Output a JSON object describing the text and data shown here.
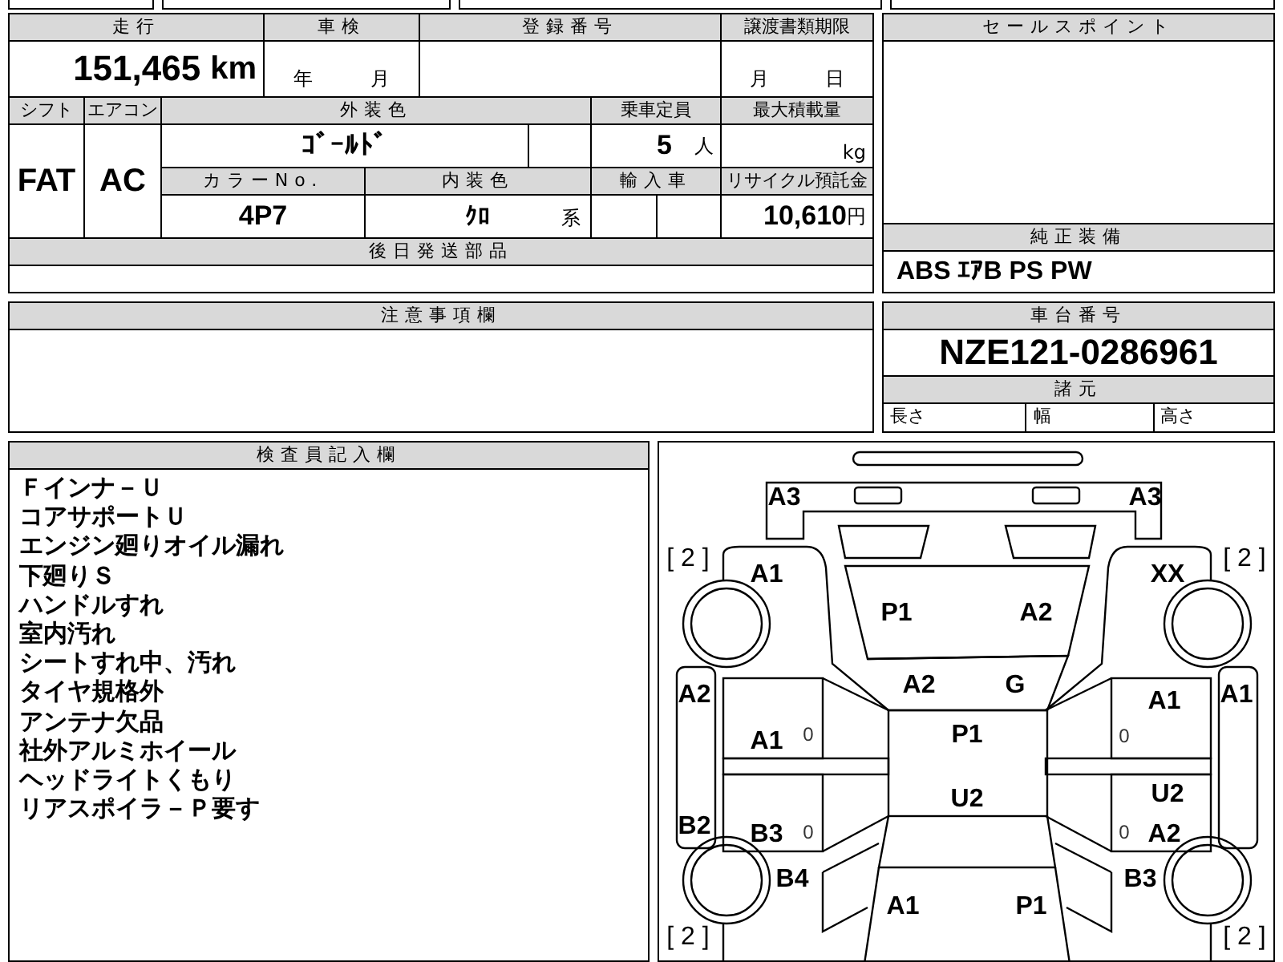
{
  "mileage": {
    "label": "走行",
    "value": "151,465",
    "unit": "km"
  },
  "inspection": {
    "label": "車検",
    "year_unit": "年",
    "month_unit": "月"
  },
  "registration_number": {
    "label": "登録番号"
  },
  "transfer_deadline": {
    "label": "譲渡書類期限",
    "month_unit": "月",
    "day_unit": "日"
  },
  "shift": {
    "label": "シフト",
    "value": "FAT"
  },
  "aircon": {
    "label": "エアコン",
    "value": "AC"
  },
  "exterior_color": {
    "label": "外装色",
    "value": "ｺﾞｰﾙﾄﾞ"
  },
  "capacity": {
    "label": "乗車定員",
    "value": "5",
    "unit": "人"
  },
  "max_load": {
    "label": "最大積載量",
    "unit": "kg"
  },
  "color_no": {
    "label": "カラーNo.",
    "value": "4P7"
  },
  "interior_color": {
    "label": "内装色",
    "value": "ｸﾛ",
    "suffix": "系"
  },
  "import_car": {
    "label": "輸入車"
  },
  "recycle_fee": {
    "label": "リサイクル預託金",
    "value": "10,610",
    "unit": "円"
  },
  "parts_to_send": {
    "label": "後日発送部品"
  },
  "sales_points": {
    "label": "セールスポイント"
  },
  "standard_equipment": {
    "label": "純正装備",
    "value": "ABS ｴｱB PS PW"
  },
  "notes": {
    "label": "注意事項欄"
  },
  "chassis_number": {
    "label": "車台番号",
    "value": "NZE121-0286961"
  },
  "specs": {
    "label": "諸元",
    "items": [
      "長さ",
      "幅",
      "高さ"
    ]
  },
  "inspector_notes": {
    "label": "検査員記入欄",
    "lines": [
      "Ｆインナ－Ｕ",
      "コアサポートＵ",
      "エンジン廻りオイル漏れ",
      "下廻りＳ",
      "ハンドルすれ",
      "室内汚れ",
      "シートすれ中、汚れ",
      "タイヤ規格外",
      "アンテナ欠品",
      "社外アルミホイール",
      "ヘッドライトくもり",
      "リアスポイラ－Ｐ要す"
    ]
  },
  "damage_diagram": {
    "marks": [
      {
        "text": "A3",
        "kind": "code"
      },
      {
        "text": "A3",
        "kind": "code"
      },
      {
        "text": "[ 2 ]",
        "kind": "tread"
      },
      {
        "text": "[ 2 ]",
        "kind": "tread"
      },
      {
        "text": "A1",
        "kind": "code"
      },
      {
        "text": "XX",
        "kind": "code"
      },
      {
        "text": "P1",
        "kind": "code"
      },
      {
        "text": "A2",
        "kind": "code"
      },
      {
        "text": "A2",
        "kind": "code"
      },
      {
        "text": "A2",
        "kind": "code"
      },
      {
        "text": "G",
        "kind": "code"
      },
      {
        "text": "A1",
        "kind": "code"
      },
      {
        "text": "A1",
        "kind": "code"
      },
      {
        "text": "A1",
        "kind": "code"
      },
      {
        "text": "0",
        "kind": "minor"
      },
      {
        "text": "P1",
        "kind": "code"
      },
      {
        "text": "0",
        "kind": "minor"
      },
      {
        "text": "U2",
        "kind": "code"
      },
      {
        "text": "U2",
        "kind": "code"
      },
      {
        "text": "B2",
        "kind": "code"
      },
      {
        "text": "B3",
        "kind": "code"
      },
      {
        "text": "0",
        "kind": "minor"
      },
      {
        "text": "0",
        "kind": "minor"
      },
      {
        "text": "A2",
        "kind": "code"
      },
      {
        "text": "B4",
        "kind": "code"
      },
      {
        "text": "B3",
        "kind": "code"
      },
      {
        "text": "A1",
        "kind": "code"
      },
      {
        "text": "P1",
        "kind": "code"
      },
      {
        "text": "[ 2 ]",
        "kind": "tread"
      },
      {
        "text": "[ 2 ]",
        "kind": "tread"
      }
    ]
  }
}
